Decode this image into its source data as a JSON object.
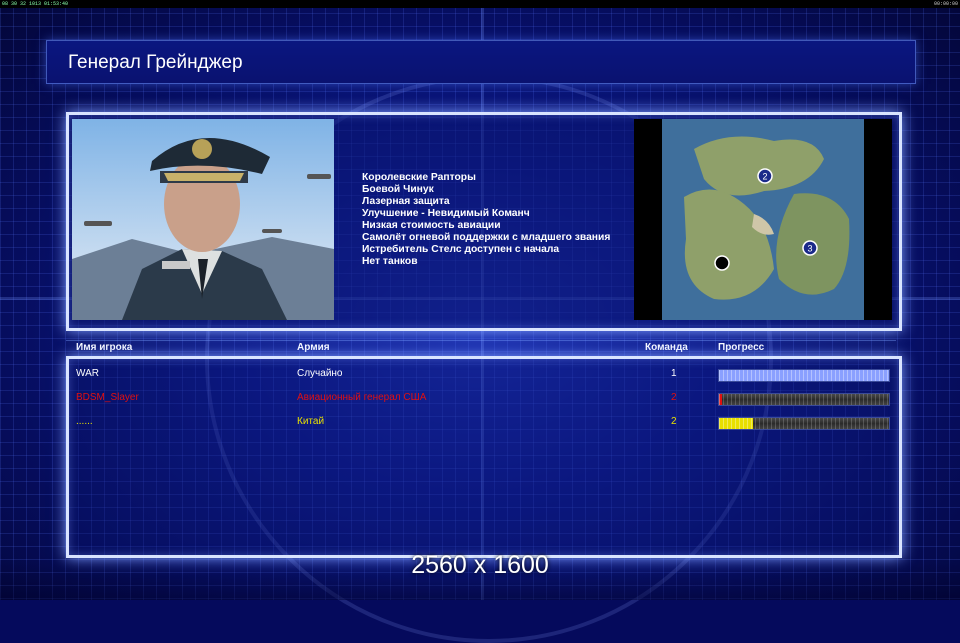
{
  "status_bar": {
    "left": "08 30 32 1013 01:53:40",
    "right": "00:00:00"
  },
  "general": {
    "title": "Генерал Грейнджер",
    "features": [
      "Королевские Рапторы",
      "Боевой Чинук",
      "Лазерная защита",
      "Улучшение - Невидимый Команч",
      "Низкая стоимость авиации",
      "Самолёт огневой поддержки с младшего звания",
      "Истребитель Стелс доступен с начала",
      "Нет танков"
    ]
  },
  "minimap": {
    "markers": [
      "2",
      "3",
      ""
    ]
  },
  "table": {
    "headers": {
      "player": "Имя игрока",
      "army": "Армия",
      "team": "Команда",
      "progress": "Прогресс"
    },
    "rows": [
      {
        "name": "WAR",
        "army": "Случайно",
        "team": "1",
        "progress": 1.0,
        "color": "#ffffff"
      },
      {
        "name": "BDSM_Slayer",
        "army": "Авиационный генерал США",
        "team": "2",
        "progress": 0.02,
        "color": "#e01010"
      },
      {
        "name": "......",
        "army": "Китай",
        "team": "2",
        "progress": 0.2,
        "color": "#e8e000"
      }
    ]
  },
  "resolution_label": "2560 x 1600",
  "colors": {
    "accent": "#d9e4ff",
    "background": "#0d1a8a"
  }
}
